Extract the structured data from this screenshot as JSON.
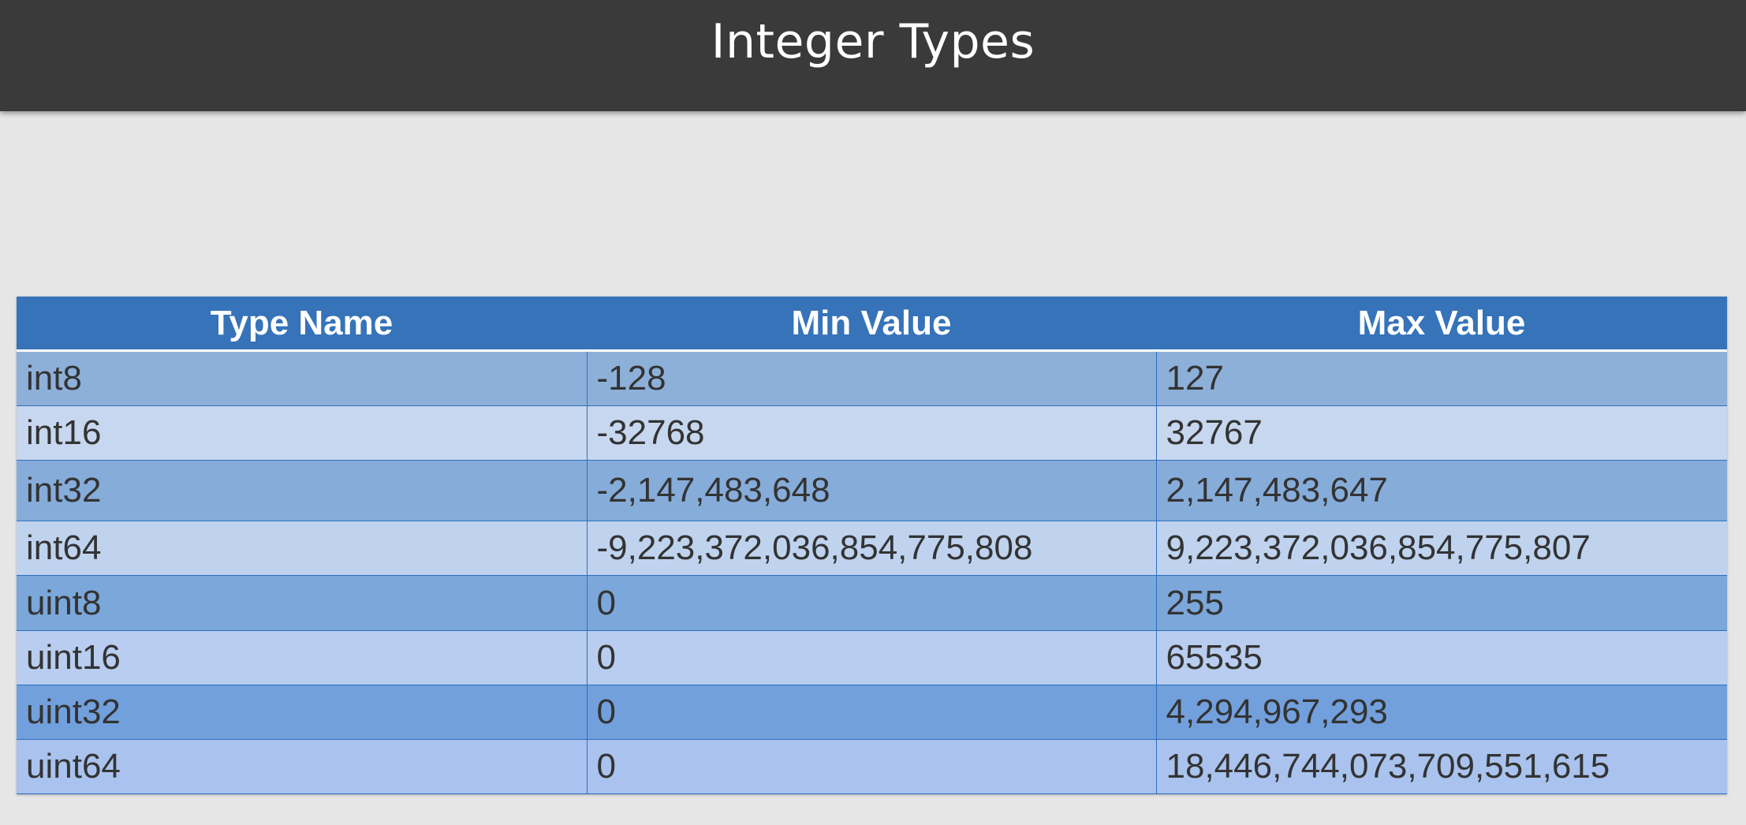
{
  "slide": {
    "title": "Integer Types"
  },
  "table": {
    "headers": [
      "Type Name",
      "Min Value",
      "Max Value"
    ],
    "rows": [
      [
        "int8",
        "-128",
        "127"
      ],
      [
        "int16",
        "-32768",
        "32767"
      ],
      [
        "int32",
        "-2,147,483,648",
        "2,147,483,647"
      ],
      [
        "int64",
        "-9,223,372,036,854,775,808",
        "9,223,372,036,854,775,807"
      ],
      [
        "uint8",
        "0",
        "255"
      ],
      [
        "uint16",
        "0",
        "65535"
      ],
      [
        "uint32",
        "0",
        "4,294,967,293"
      ],
      [
        "uint64",
        "0",
        "18,446,744,073,709,551,615"
      ]
    ]
  },
  "colors": {
    "title_bar": "#3a3a3a",
    "header": "#3673b9",
    "background": "#e6e6e6"
  }
}
